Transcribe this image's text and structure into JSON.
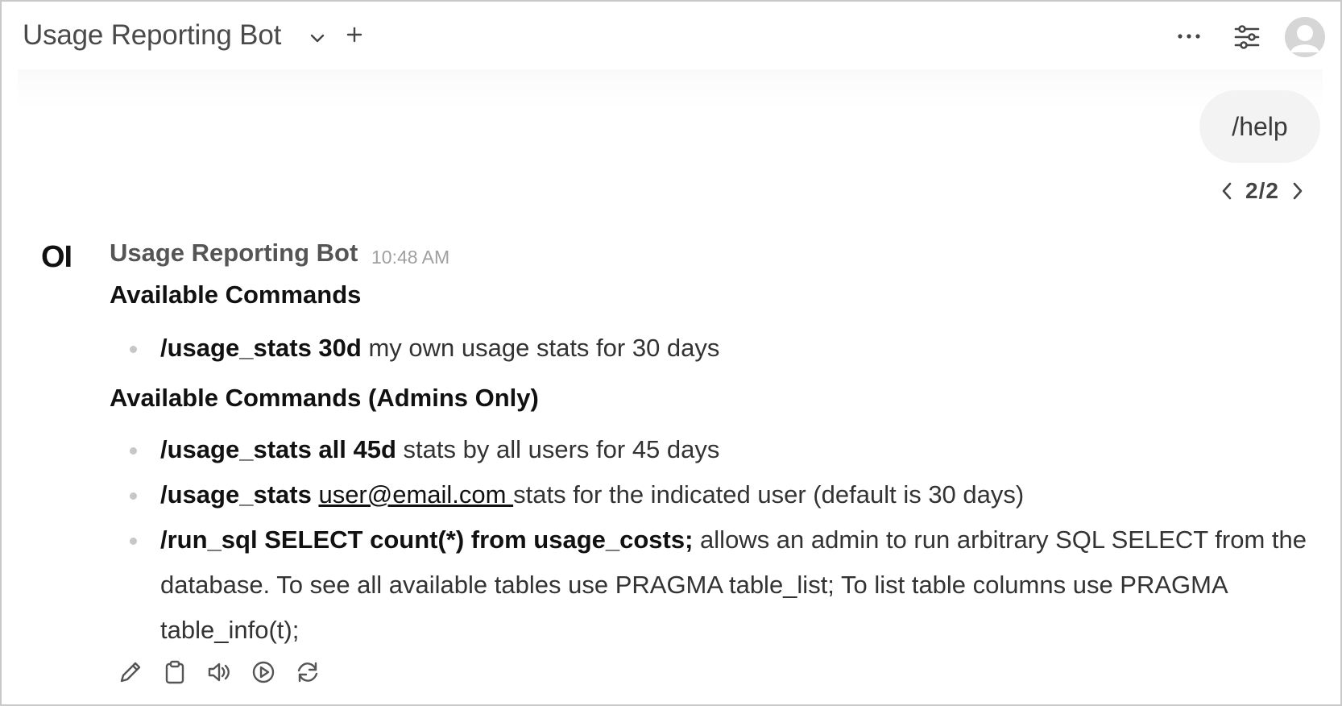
{
  "header": {
    "model_title": "Usage Reporting Bot",
    "icons": [
      "chevron-down-icon",
      "plus-icon",
      "more-dots-icon",
      "sliders-icon",
      "user-avatar"
    ]
  },
  "user_message": {
    "text": "/help",
    "pager": "2/2"
  },
  "bot_message": {
    "logo": "OI",
    "name": "Usage Reporting Bot",
    "time": "10:48 AM",
    "heading_1": "Available Commands",
    "list_1": [
      {
        "command": "/usage_stats 30d",
        "description": " my own usage stats for 30 days"
      }
    ],
    "heading_2": "Available Commands (Admins Only)",
    "list_2": [
      {
        "command": "/usage_stats all 45d",
        "description": " stats by all users for 45 days"
      },
      {
        "command": "/usage_stats",
        "link": "user@email.com ",
        "description": "stats for the indicated user (default is 30 days)"
      },
      {
        "command": "/run_sql SELECT count(*) from usage_costs;",
        "description": " allows an admin to run arbitrary SQL SELECT from the database. To see all available tables use PRAGMA table_list; To list table columns use PRAGMA table_info(t);"
      }
    ],
    "actions": [
      "edit-icon",
      "copy-icon",
      "speaker-icon",
      "play-icon",
      "regenerate-icon"
    ]
  },
  "colors": {
    "bubble_bg": "#f3f3f3",
    "border": "#c9c9c9",
    "bullet": "#c7c7c7"
  }
}
